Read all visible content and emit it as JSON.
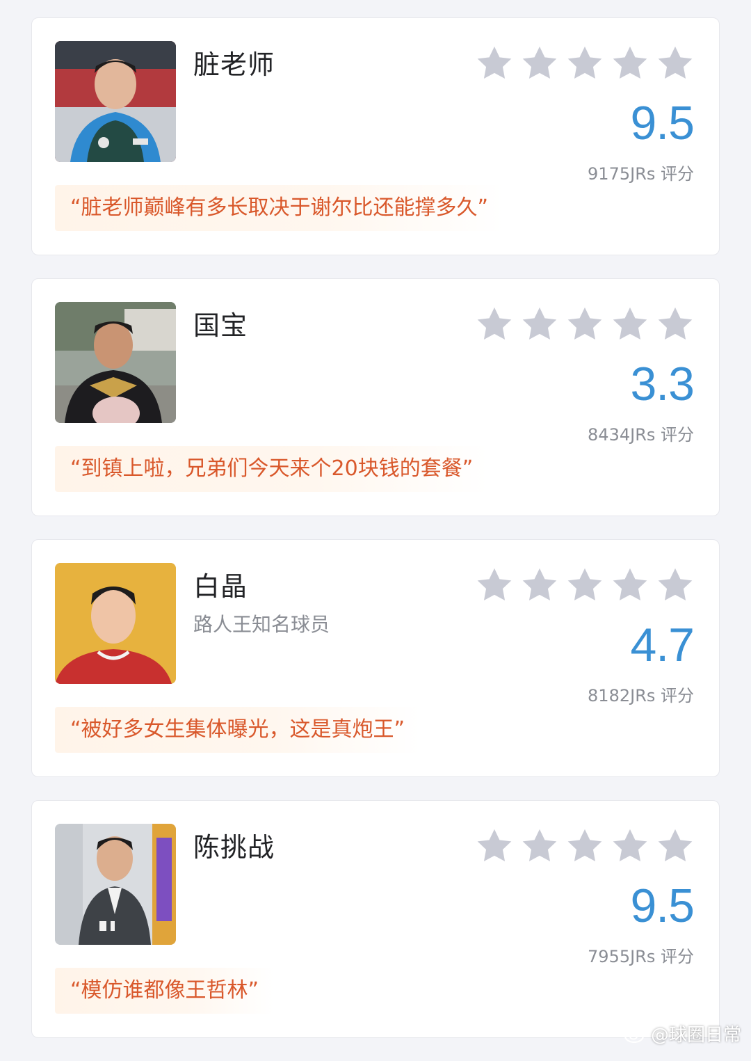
{
  "cards": [
    {
      "name": "脏老师",
      "subtitle": "",
      "score": "9.5",
      "raters": "9175JRs 评分",
      "quote": "“脏老师巅峰有多长取决于谢尔比还能撑多久”",
      "stars_filled": 0
    },
    {
      "name": "国宝",
      "subtitle": "",
      "score": "3.3",
      "raters": "8434JRs 评分",
      "quote": "“到镇上啦，兄弟们今天来个20块钱的套餐”",
      "stars_filled": 0
    },
    {
      "name": "白晶",
      "subtitle": "路人王知名球员",
      "score": "4.7",
      "raters": "8182JRs 评分",
      "quote": "“被好多女生集体曝光，这是真炮王”",
      "stars_filled": 0
    },
    {
      "name": "陈挑战",
      "subtitle": "",
      "score": "9.5",
      "raters": "7955JRs 评分",
      "quote": "“模仿谁都像王哲林”",
      "stars_filled": 0
    }
  ],
  "watermark": "@球圈日常",
  "colors": {
    "score": "#3a90d4",
    "quote_text": "#d9582b",
    "quote_bg": "#fff4e9",
    "star": "#c8cad4"
  },
  "icons": {
    "star": "star-icon",
    "watermark": "weibo-logo-icon"
  }
}
